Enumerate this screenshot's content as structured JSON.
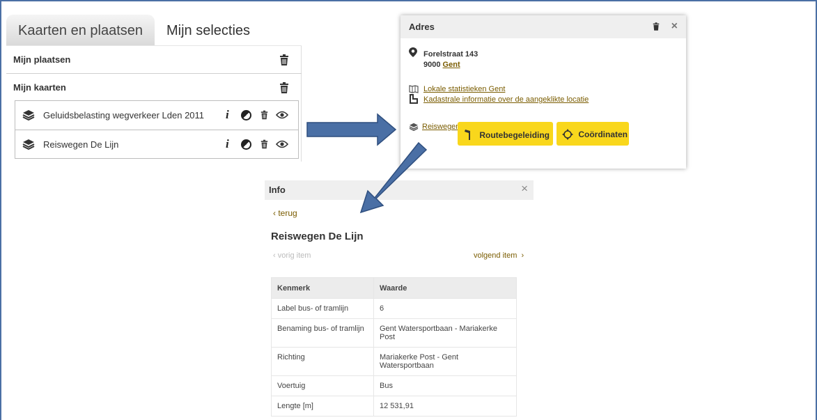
{
  "left_panel": {
    "tabs": [
      {
        "label": "Kaarten en plaatsen"
      },
      {
        "label": "Mijn selecties"
      }
    ],
    "sections": [
      {
        "label": "Mijn plaatsen"
      },
      {
        "label": "Mijn kaarten"
      }
    ],
    "layers": [
      {
        "label": "Geluidsbelasting wegverkeer Lden 2011"
      },
      {
        "label": "Reiswegen De Lijn"
      }
    ],
    "info_glyph": "i"
  },
  "address_popup": {
    "title": "Adres",
    "close": "×",
    "street": "Forelstraat 143",
    "postcode": "9000",
    "city": "Gent",
    "links": [
      {
        "label": "Lokale statistieken Gent",
        "icon": "map-book-icon"
      },
      {
        "label": "Kadastrale informatie over de aangeklikte locatie",
        "icon": "parcel-icon"
      },
      {
        "label": "Reiswegen De Lijn",
        "icon": "layers-icon"
      }
    ],
    "buttons": {
      "route": "Routebegeleiding",
      "coords": "Coördinaten"
    },
    "accent_color": "#f9d71c"
  },
  "info_panel": {
    "title": "Info",
    "close": "×",
    "back": "terug",
    "heading": "Reiswegen De Lijn",
    "prev": "vorig item",
    "next": "volgend item",
    "table": {
      "headers": [
        "Kenmerk",
        "Waarde"
      ],
      "rows": [
        [
          "Label bus- of tramlijn",
          "6"
        ],
        [
          "Benaming bus- of tramlijn",
          "Gent Watersportbaan - Mariakerke Post"
        ],
        [
          "Richting",
          "Mariakerke Post - Gent Watersportbaan"
        ],
        [
          "Voertuig",
          "Bus"
        ],
        [
          "Lengte [m]",
          "12 531,91"
        ]
      ]
    }
  },
  "colors": {
    "arrow": "#4a6fa5",
    "link": "#7a5c00"
  }
}
